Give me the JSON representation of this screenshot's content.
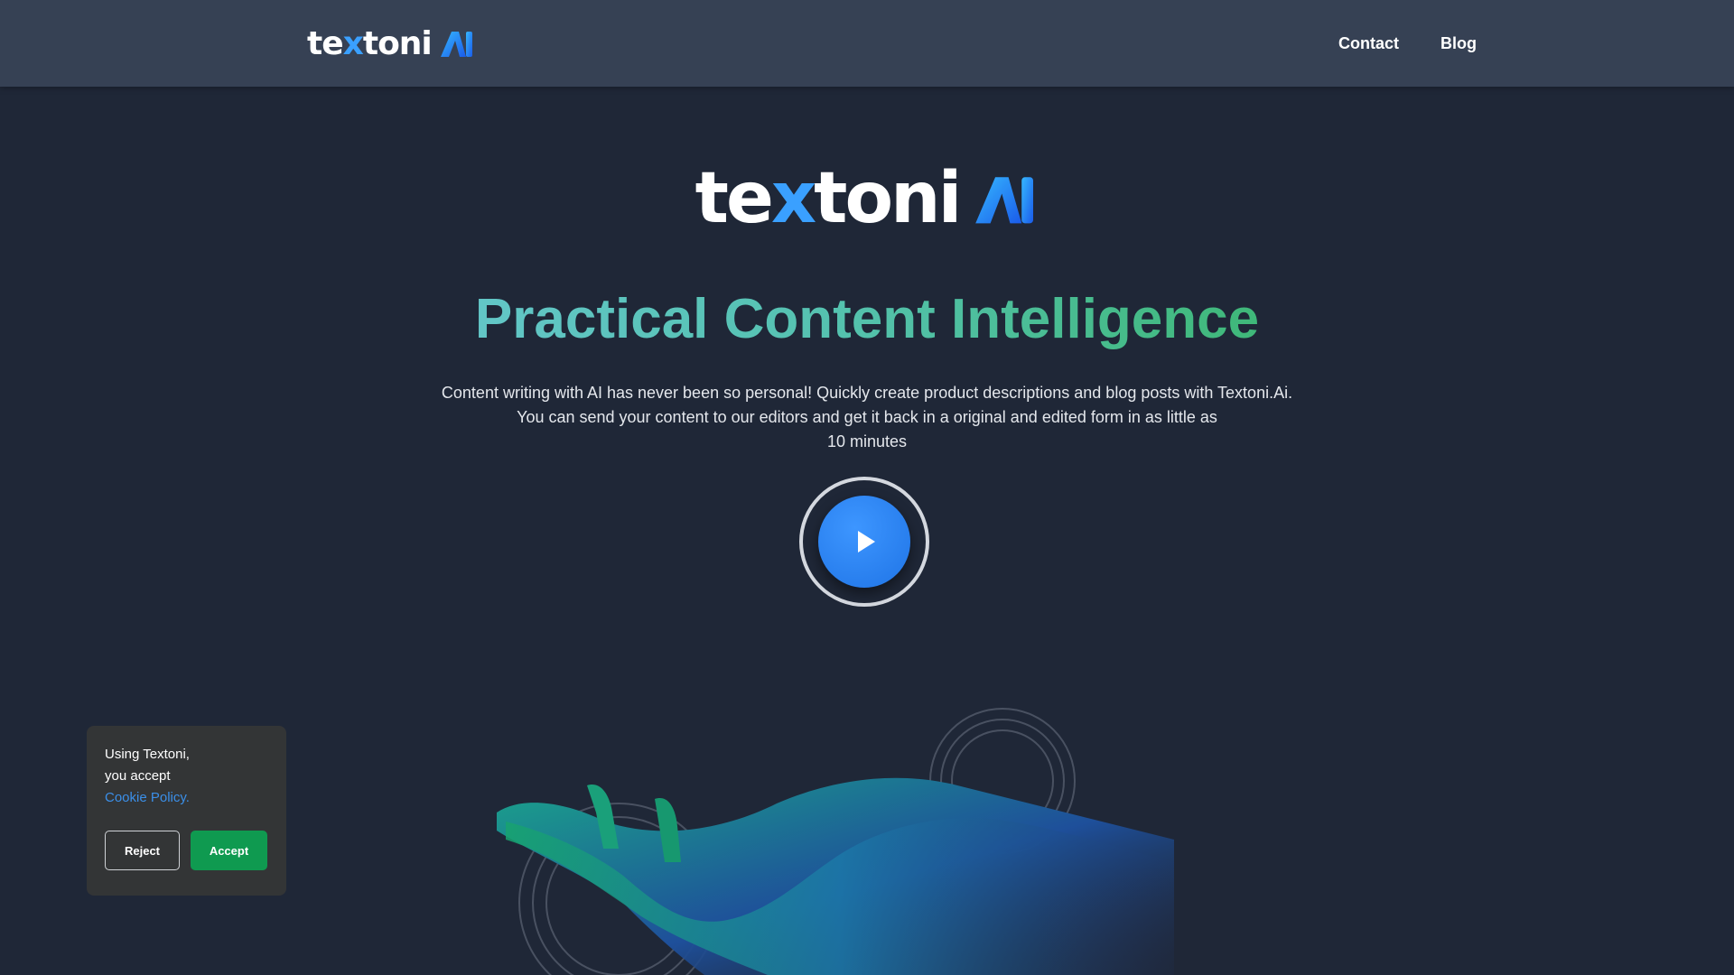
{
  "header": {
    "logo_text": "textoni",
    "logo_ai": "AI",
    "nav": [
      {
        "label": "Contact"
      },
      {
        "label": "Blog"
      }
    ]
  },
  "hero": {
    "logo_text": "textoni",
    "logo_ai": "AI",
    "headline": "Practical Content Intelligence",
    "description_lines": [
      "Content writing with AI has never been so personal! Quickly create product descriptions and blog posts with Textoni.Ai.",
      "You can send your content to our editors and get it back in a original and edited form in as little as",
      "10 minutes"
    ],
    "play_icon": "play-icon"
  },
  "cookie_banner": {
    "line1": "Using Textoni,",
    "line2": "you accept",
    "link": "Cookie Policy.",
    "reject_label": "Reject",
    "accept_label": "Accept"
  },
  "colors": {
    "background": "#1f2737",
    "header": "#364154",
    "accent_blue": "#2a86f5",
    "accept_green": "#0f9a50",
    "headline_gradient": [
      "#62c6c7",
      "#3fb879"
    ]
  }
}
